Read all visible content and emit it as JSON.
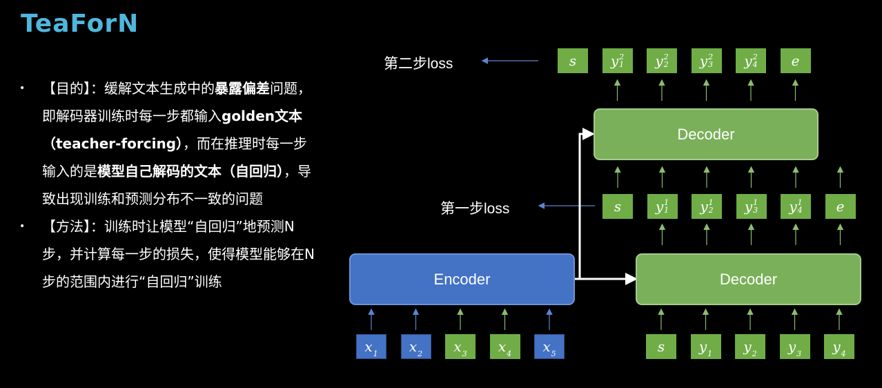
{
  "title": "TeaForN",
  "colors": {
    "title": "#4fb7dc",
    "decoder": "#70ad47",
    "encoder": "#4472c4",
    "arrow_blue": "#4472c4",
    "arrow_green": "#70ad47"
  },
  "bullets": [
    {
      "parts": [
        {
          "text": "【目的】：缓解文本生成中的",
          "bold": false
        },
        {
          "text": "暴露偏差",
          "bold": true
        },
        {
          "text": "问题，即解码器训练时每一步都输入",
          "bold": false
        },
        {
          "text": "golden文本（teacher-forcing）",
          "bold": true
        },
        {
          "text": "，而在推理时每一步输入的是",
          "bold": false
        },
        {
          "text": "模型自己解码的文本（自回归）",
          "bold": true
        },
        {
          "text": "，导致出现训练和预测分布不一致的问题",
          "bold": false
        }
      ]
    },
    {
      "parts": [
        {
          "text": "【方法】：训练时让模型“自回归”地预测N步，并计算每一步的损失，使得模型能够在N步的范围内进行“自回归”训练",
          "bold": false
        }
      ]
    }
  ],
  "diagram": {
    "encoder_label": "Encoder",
    "decoder1_label": "Decoder",
    "decoder2_label": "Decoder",
    "loss1_label": "第一步loss",
    "loss2_label": "第二步loss",
    "encoder_inputs": [
      {
        "base": "x",
        "sub": "1",
        "sup": ""
      },
      {
        "base": "x",
        "sub": "2",
        "sup": ""
      },
      {
        "base": "x",
        "sub": "3",
        "sup": ""
      },
      {
        "base": "x",
        "sub": "4",
        "sup": ""
      },
      {
        "base": "x",
        "sub": "5",
        "sup": ""
      }
    ],
    "decoder1_inputs": [
      {
        "base": "s",
        "sub": "",
        "sup": ""
      },
      {
        "base": "y",
        "sub": "1",
        "sup": ""
      },
      {
        "base": "y",
        "sub": "2",
        "sup": ""
      },
      {
        "base": "y",
        "sub": "3",
        "sup": ""
      },
      {
        "base": "y",
        "sub": "4",
        "sup": ""
      }
    ],
    "decoder1_outputs": [
      {
        "base": "s",
        "sub": "",
        "sup": ""
      },
      {
        "base": "y",
        "sub": "1",
        "sup": "1"
      },
      {
        "base": "y",
        "sub": "2",
        "sup": "1"
      },
      {
        "base": "y",
        "sub": "3",
        "sup": "1"
      },
      {
        "base": "y",
        "sub": "4",
        "sup": "1"
      },
      {
        "base": "e",
        "sub": "",
        "sup": ""
      }
    ],
    "decoder2_outputs": [
      {
        "base": "s",
        "sub": "",
        "sup": ""
      },
      {
        "base": "y",
        "sub": "1",
        "sup": "2"
      },
      {
        "base": "y",
        "sub": "2",
        "sup": "2"
      },
      {
        "base": "y",
        "sub": "3",
        "sup": "2"
      },
      {
        "base": "y",
        "sub": "4",
        "sup": "2"
      },
      {
        "base": "e",
        "sub": "",
        "sup": ""
      }
    ]
  }
}
